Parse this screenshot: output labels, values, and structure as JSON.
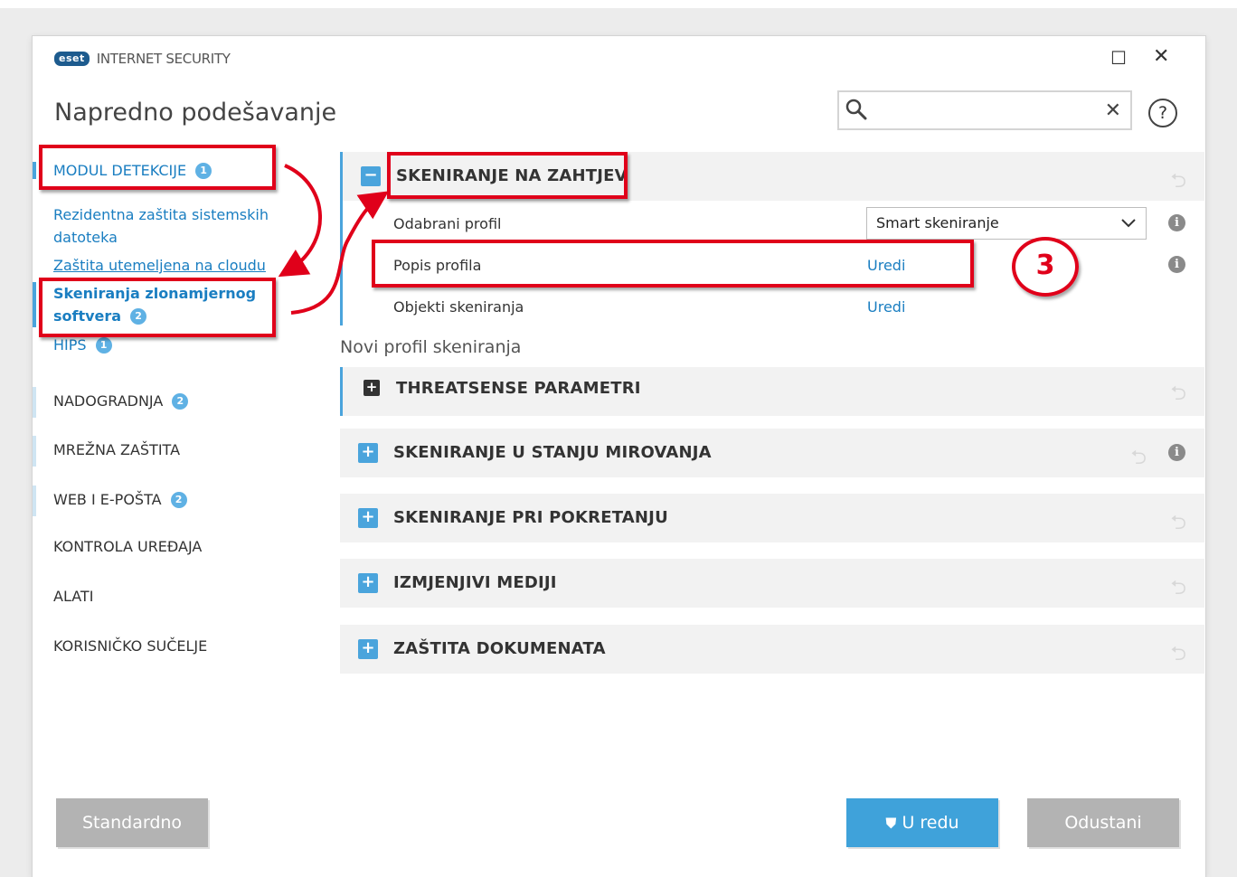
{
  "header": {
    "brand_logo": "eset",
    "product_name": "INTERNET SECURITY",
    "title": "Napredno podešavanje",
    "search": {
      "value": "",
      "placeholder": ""
    },
    "icons": {
      "search": "search-icon",
      "clear": "close-icon",
      "help": "help-icon",
      "maximize": "maximize-icon",
      "close": "close-icon"
    }
  },
  "sidebar": {
    "categories": [
      {
        "label": "MODUL DETEKCIJE",
        "badge": "1"
      },
      {
        "label": "NADOGRADNJA",
        "badge": "2"
      },
      {
        "label": "MREŽNA ZAŠTITA"
      },
      {
        "label": "WEB I E-POŠTA",
        "badge": "2"
      },
      {
        "label": "KONTROLA UREĐAJA"
      },
      {
        "label": "ALATI"
      },
      {
        "label": "KORISNIČKO SUČELJE"
      }
    ],
    "sub_items": [
      {
        "label": "Rezidentna zaštita sistemskih datoteka"
      },
      {
        "label": "Zaštita utemeljena na cloudu"
      },
      {
        "label": "Skeniranja zlonamjernog softvera",
        "badge": "2"
      },
      {
        "label": "HIPS",
        "badge": "1"
      }
    ]
  },
  "main": {
    "expanded_section": {
      "title": "SKENIRANJE NA ZAHTJEV",
      "rows": [
        {
          "label": "Odabrani profil",
          "select_value": "Smart skeniranje"
        },
        {
          "label": "Popis profila",
          "link": "Uredi"
        },
        {
          "label": "Objekti skeniranja",
          "link": "Uredi"
        }
      ]
    },
    "profile_heading": "Novi profil skeniranja",
    "threatsense": "THREATSENSE PARAMETRI",
    "collapsed_sections": [
      "SKENIRANJE U STANJU MIROVANJA",
      "SKENIRANJE PRI POKRETANJU",
      "IZMJENJIVI MEDIJI",
      "ZAŠTITA DOKUMENATA"
    ]
  },
  "footer": {
    "default_button": "Standardno",
    "ok_button": "U redu",
    "cancel_button": "Odustani"
  },
  "annotation": {
    "step_number": "3",
    "color": "#e0001a"
  },
  "colors": {
    "accent": "#4aa4dc",
    "link": "#1a7ec1",
    "brand": "#1d5b8e",
    "annotation": "#e0001a"
  }
}
